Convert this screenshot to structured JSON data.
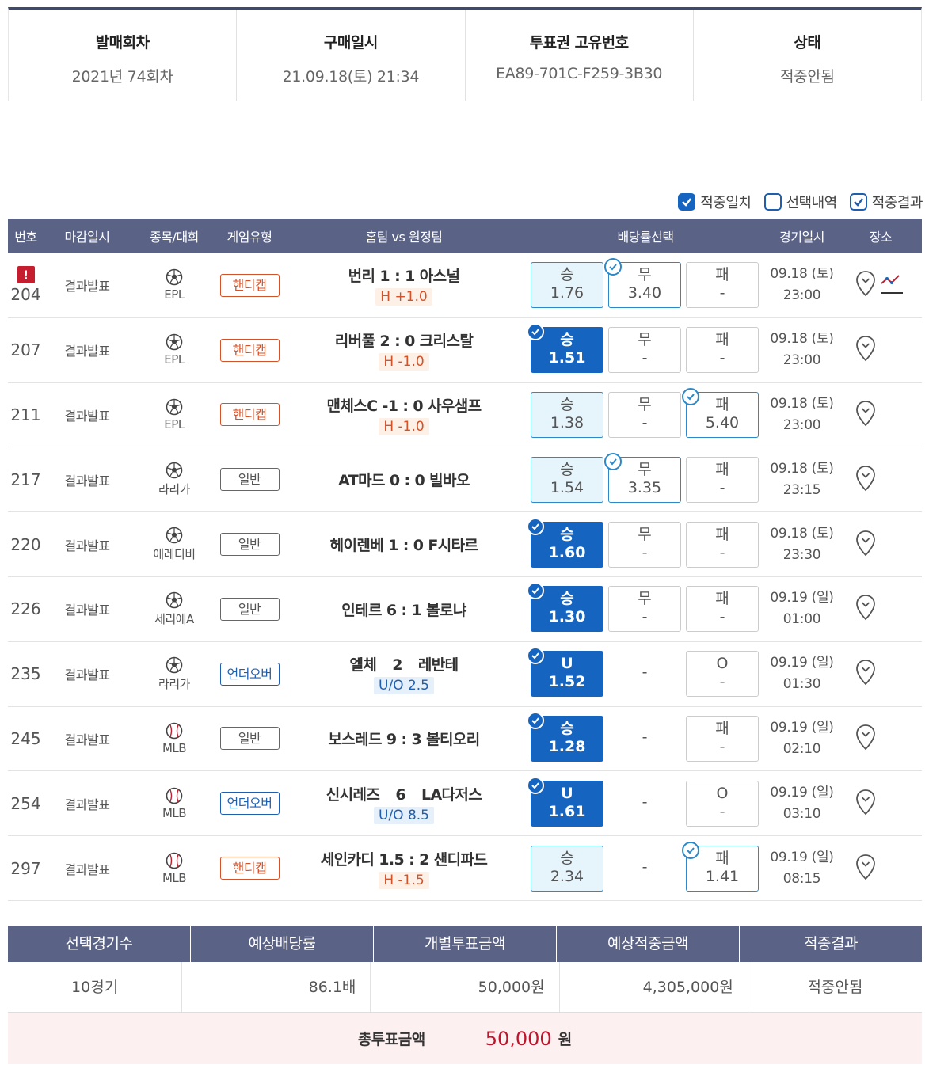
{
  "summary": [
    {
      "label": "발매회차",
      "value": "2021년 74회차"
    },
    {
      "label": "구매일시",
      "value": "21.09.18(토) 21:34"
    },
    {
      "label": "투표권 고유번호",
      "value": "EA89-701C-F259-3B30"
    },
    {
      "label": "상태",
      "value": "적중안됨"
    }
  ],
  "legend": {
    "match": "적중일치",
    "selection": "선택내역",
    "result": "적중결과"
  },
  "table_header": {
    "no": "번호",
    "close": "마감일시",
    "sport": "종목/대회",
    "type": "게임유형",
    "teams": "홈팀 vs 원정팀",
    "odds": "배당률선택",
    "date": "경기일시",
    "place": "장소"
  },
  "rows": [
    {
      "no": "204",
      "close": "결과발표",
      "sport_icon": "soccer-ball-icon",
      "league": "EPL",
      "type": "핸디캡",
      "type_kind": "hc",
      "home": "번리 1",
      "sep": ":",
      "away": "1 아스널",
      "tag": "H +1.0",
      "tag_kind": "h",
      "odds": [
        {
          "label": "승",
          "value": "1.76",
          "state": "sel",
          "check": false
        },
        {
          "label": "무",
          "value": "3.40",
          "state": "pick",
          "check": true
        },
        {
          "label": "패",
          "value": "-",
          "state": "",
          "check": false
        }
      ],
      "date": "09.18 (토)",
      "time": "23:00",
      "alert": true,
      "chart": true
    },
    {
      "no": "207",
      "close": "결과발표",
      "sport_icon": "soccer-ball-icon",
      "league": "EPL",
      "type": "핸디캡",
      "type_kind": "hc",
      "home": "리버풀 2",
      "sep": ":",
      "away": "0 크리스탈",
      "tag": "H -1.0",
      "tag_kind": "h",
      "odds": [
        {
          "label": "승",
          "value": "1.51",
          "state": "hit",
          "check": true
        },
        {
          "label": "무",
          "value": "-",
          "state": "",
          "check": false
        },
        {
          "label": "패",
          "value": "-",
          "state": "",
          "check": false
        }
      ],
      "date": "09.18 (토)",
      "time": "23:00"
    },
    {
      "no": "211",
      "close": "결과발표",
      "sport_icon": "soccer-ball-icon",
      "league": "EPL",
      "type": "핸디캡",
      "type_kind": "hc",
      "home": "맨체스C -1",
      "sep": ":",
      "away": "0 사우샘프",
      "tag": "H -1.0",
      "tag_kind": "h",
      "odds": [
        {
          "label": "승",
          "value": "1.38",
          "state": "sel",
          "check": false
        },
        {
          "label": "무",
          "value": "-",
          "state": "",
          "check": false
        },
        {
          "label": "패",
          "value": "5.40",
          "state": "pick",
          "check": true
        }
      ],
      "date": "09.18 (토)",
      "time": "23:00"
    },
    {
      "no": "217",
      "close": "결과발표",
      "sport_icon": "soccer-ball-icon",
      "league": "라리가",
      "type": "일반",
      "type_kind": "gen",
      "home": "AT마드 0",
      "sep": ":",
      "away": "0 빌바오",
      "tag": "",
      "tag_kind": "",
      "odds": [
        {
          "label": "승",
          "value": "1.54",
          "state": "sel",
          "check": false
        },
        {
          "label": "무",
          "value": "3.35",
          "state": "pick",
          "check": true
        },
        {
          "label": "패",
          "value": "-",
          "state": "",
          "check": false
        }
      ],
      "date": "09.18 (토)",
      "time": "23:15"
    },
    {
      "no": "220",
      "close": "결과발표",
      "sport_icon": "soccer-ball-icon",
      "league": "에레디비",
      "type": "일반",
      "type_kind": "gen",
      "home": "헤이렌베 1",
      "sep": ":",
      "away": "0 F시타르",
      "tag": "",
      "tag_kind": "",
      "odds": [
        {
          "label": "승",
          "value": "1.60",
          "state": "hit",
          "check": true
        },
        {
          "label": "무",
          "value": "-",
          "state": "",
          "check": false
        },
        {
          "label": "패",
          "value": "-",
          "state": "",
          "check": false
        }
      ],
      "date": "09.18 (토)",
      "time": "23:30"
    },
    {
      "no": "226",
      "close": "결과발표",
      "sport_icon": "soccer-ball-icon",
      "league": "세리에A",
      "type": "일반",
      "type_kind": "gen",
      "home": "인테르 6",
      "sep": ":",
      "away": "1 볼로냐",
      "tag": "",
      "tag_kind": "",
      "odds": [
        {
          "label": "승",
          "value": "1.30",
          "state": "hit",
          "check": true
        },
        {
          "label": "무",
          "value": "-",
          "state": "",
          "check": false
        },
        {
          "label": "패",
          "value": "-",
          "state": "",
          "check": false
        }
      ],
      "date": "09.19 (일)",
      "time": "01:00"
    },
    {
      "no": "235",
      "close": "결과발표",
      "sport_icon": "soccer-ball-icon",
      "league": "라리가",
      "type": "언더오버",
      "type_kind": "uo",
      "home": "엘체",
      "sep": "2",
      "away": "레반테",
      "tag": "U/O 2.5",
      "tag_kind": "u",
      "odds": [
        {
          "label": "U",
          "value": "1.52",
          "state": "hit",
          "check": true
        },
        {
          "label": "-",
          "value": "",
          "state": "none",
          "check": false
        },
        {
          "label": "O",
          "value": "-",
          "state": "",
          "check": false
        }
      ],
      "date": "09.19 (일)",
      "time": "01:30"
    },
    {
      "no": "245",
      "close": "결과발표",
      "sport_icon": "baseball-icon",
      "league": "MLB",
      "type": "일반",
      "type_kind": "gen",
      "home": "보스레드 9",
      "sep": ":",
      "away": "3 볼티오리",
      "tag": "",
      "tag_kind": "",
      "odds": [
        {
          "label": "승",
          "value": "1.28",
          "state": "hit",
          "check": true
        },
        {
          "label": "-",
          "value": "",
          "state": "none",
          "check": false
        },
        {
          "label": "패",
          "value": "-",
          "state": "",
          "check": false
        }
      ],
      "date": "09.19 (일)",
      "time": "02:10"
    },
    {
      "no": "254",
      "close": "결과발표",
      "sport_icon": "baseball-icon",
      "league": "MLB",
      "type": "언더오버",
      "type_kind": "uo",
      "home": "신시레즈",
      "sep": "6",
      "away": "LA다저스",
      "tag": "U/O 8.5",
      "tag_kind": "u",
      "odds": [
        {
          "label": "U",
          "value": "1.61",
          "state": "hit",
          "check": true
        },
        {
          "label": "-",
          "value": "",
          "state": "none",
          "check": false
        },
        {
          "label": "O",
          "value": "-",
          "state": "",
          "check": false
        }
      ],
      "date": "09.19 (일)",
      "time": "03:10"
    },
    {
      "no": "297",
      "close": "결과발표",
      "sport_icon": "baseball-icon",
      "league": "MLB",
      "type": "핸디캡",
      "type_kind": "hc",
      "home": "세인카디 1.5",
      "sep": ":",
      "away": "2 샌디파드",
      "tag": "H -1.5",
      "tag_kind": "h",
      "odds": [
        {
          "label": "승",
          "value": "2.34",
          "state": "sel",
          "check": false
        },
        {
          "label": "-",
          "value": "",
          "state": "none",
          "check": false
        },
        {
          "label": "패",
          "value": "1.41",
          "state": "pick",
          "check": true
        }
      ],
      "date": "09.19 (일)",
      "time": "08:15"
    }
  ],
  "bottom": {
    "headers": [
      "선택경기수",
      "예상배당률",
      "개별투표금액",
      "예상적중금액",
      "적중결과"
    ],
    "values": [
      "10경기",
      "86.1배",
      "50,000원",
      "4,305,000원",
      "적중안됨"
    ],
    "total_label": "총투표금액",
    "total_value": "50,000",
    "total_unit": "원"
  },
  "colors": {
    "header_bg": "#5a6286",
    "hit": "#1565c0",
    "selected_bg": "#e6f4fb",
    "handicap": "#d2522a",
    "alert": "#c51e2e",
    "total_value": "#c0142d"
  }
}
